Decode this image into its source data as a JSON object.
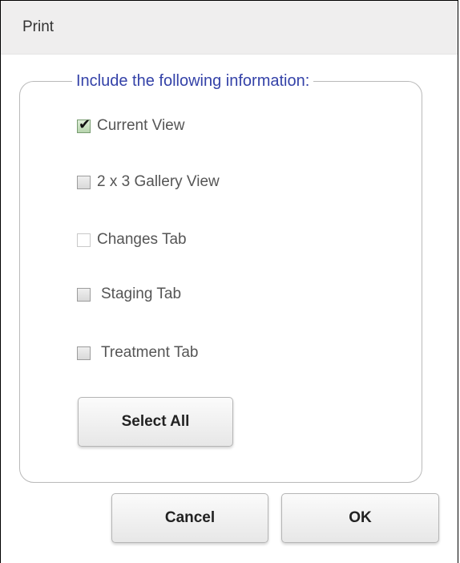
{
  "dialog": {
    "title": "Print",
    "group_legend": "Include the following information:",
    "options": [
      {
        "label": "Current View",
        "checked": true
      },
      {
        "label": "2 x 3 Gallery View",
        "checked": false
      },
      {
        "label": "Changes Tab",
        "checked": false
      },
      {
        "label": "Staging Tab",
        "checked": false
      },
      {
        "label": "Treatment Tab",
        "checked": false
      }
    ],
    "select_all_label": "Select All",
    "cancel_label": "Cancel",
    "ok_label": "OK"
  },
  "icons": {
    "checkmark": "✔"
  }
}
